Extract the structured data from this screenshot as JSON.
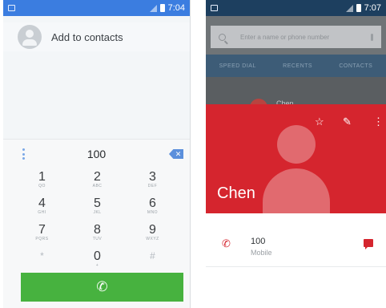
{
  "left_phone": {
    "status_time": "7:04",
    "add_contacts_label": "Add to contacts",
    "dialed_digits": "100",
    "keys": [
      {
        "num": "1",
        "sub": "QO"
      },
      {
        "num": "2",
        "sub": "ABC"
      },
      {
        "num": "3",
        "sub": "DEF"
      },
      {
        "num": "4",
        "sub": "GHI"
      },
      {
        "num": "5",
        "sub": "JKL"
      },
      {
        "num": "6",
        "sub": "MNO"
      },
      {
        "num": "7",
        "sub": "PQRS"
      },
      {
        "num": "8",
        "sub": "TUV"
      },
      {
        "num": "9",
        "sub": "WXYZ"
      },
      {
        "num": "*",
        "sub": ""
      },
      {
        "num": "0",
        "sub": "+"
      },
      {
        "num": "#",
        "sub": ""
      }
    ],
    "call_icon": "phone-icon"
  },
  "right_phone": {
    "status_time": "7:07",
    "search_placeholder": "Enter a name or phone number",
    "tabs": [
      "SPEED DIAL",
      "RECENTS",
      "CONTACTS"
    ],
    "list_name_partial": "Chen",
    "contact": {
      "name": "Chen",
      "phone_number": "100",
      "phone_type": "Mobile"
    }
  },
  "colors": {
    "dialer_status_bar": "#3b7de0",
    "call_button_green": "#47b23f",
    "contact_header_red": "#d5252e"
  }
}
